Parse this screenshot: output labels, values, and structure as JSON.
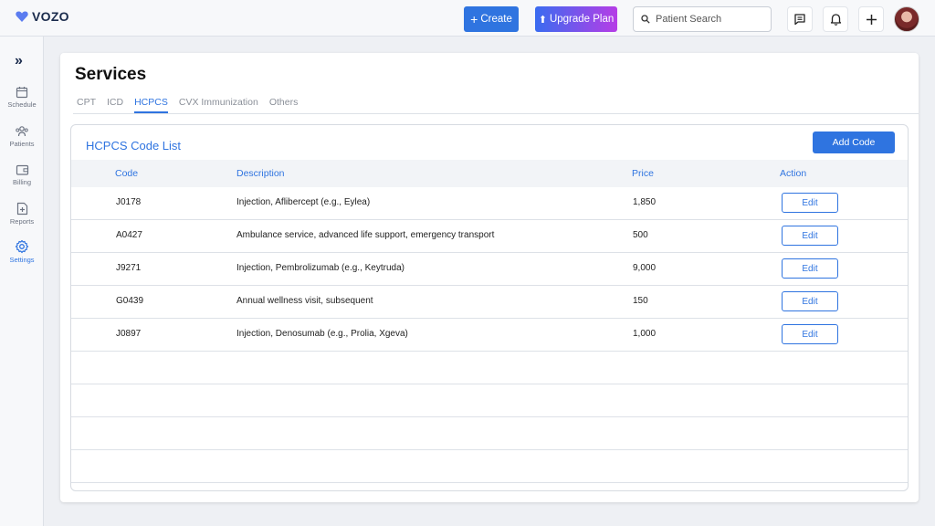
{
  "app": {
    "logo_text": "VOZO"
  },
  "topbar": {
    "create_label": "Create",
    "upgrade_label": "Upgrade Plan",
    "search_placeholder": "Patient Search"
  },
  "sidebar": {
    "items": [
      {
        "label": "Schedule",
        "icon": "calendar-icon"
      },
      {
        "label": "Patients",
        "icon": "users-icon"
      },
      {
        "label": "Billing",
        "icon": "wallet-icon"
      },
      {
        "label": "Reports",
        "icon": "report-icon"
      },
      {
        "label": "Settings",
        "icon": "gear-icon",
        "active": true
      }
    ]
  },
  "page": {
    "title": "Services",
    "tabs": [
      {
        "label": "CPT"
      },
      {
        "label": "ICD"
      },
      {
        "label": "HCPCS",
        "active": true
      },
      {
        "label": "CVX Immunization"
      },
      {
        "label": "Others"
      }
    ]
  },
  "code_list": {
    "title": "HCPCS Code List",
    "add_label": "Add Code",
    "columns": {
      "code": "Code",
      "description": "Description",
      "price": "Price",
      "action": "Action"
    },
    "edit_label": "Edit",
    "rows": [
      {
        "code": "J0178",
        "description": "Injection, Aflibercept (e.g., Eylea)",
        "price": "1,850"
      },
      {
        "code": "A0427",
        "description": "Ambulance service, advanced life support, emergency transport",
        "price": "500"
      },
      {
        "code": "J9271",
        "description": "Injection, Pembrolizumab (e.g., Keytruda)",
        "price": "9,000"
      },
      {
        "code": "G0439",
        "description": "Annual wellness visit, subsequent",
        "price": "150"
      },
      {
        "code": "J0897",
        "description": "Injection, Denosumab (e.g., Prolia, Xgeva)",
        "price": "1,000"
      }
    ]
  },
  "colors": {
    "accent": "#2f74e0",
    "upgrade_start": "#3a6cf0",
    "upgrade_end": "#b63de6"
  }
}
